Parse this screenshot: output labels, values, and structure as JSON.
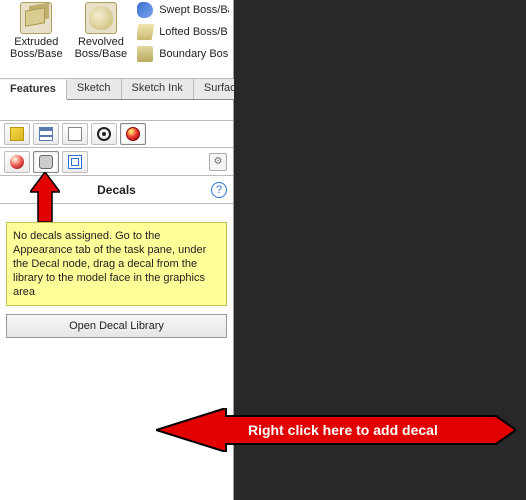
{
  "ribbon": {
    "extruded_label_line1": "Extruded",
    "extruded_label_line2": "Boss/Base",
    "revolved_label_line1": "Revolved",
    "revolved_label_line2": "Boss/Base",
    "swept_label": "Swept Boss/Ba",
    "lofted_label": "Lofted Boss/B",
    "boundary_label": "Boundary Bos"
  },
  "tabs": {
    "features": "Features",
    "sketch": "Sketch",
    "sketch_ink": "Sketch Ink",
    "surfaces": "Surfac"
  },
  "section": {
    "title": "Decals",
    "help": "?"
  },
  "note": "No decals assigned. Go to the Appearance tab of the task pane, under the Decal node, drag a decal from the library to the model face in the graphics area",
  "buttons": {
    "open_decal_library": "Open Decal Library"
  },
  "annotations": {
    "callout_text": "Right click here to add decal"
  }
}
